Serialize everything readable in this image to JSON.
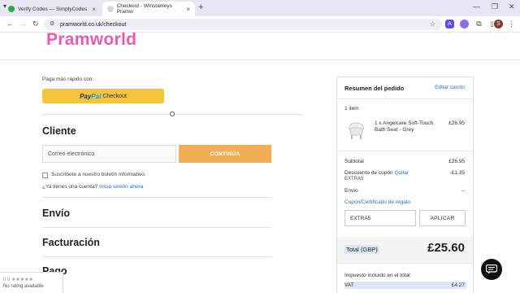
{
  "browser": {
    "tabs": [
      {
        "title": "Verify Codes — SimplyCodes",
        "active": false
      },
      {
        "title": "Checkout - Winstanleys Pramw",
        "active": true
      }
    ],
    "new_tab": "+",
    "url": "pramworld.co.uk/checkout",
    "profile_initial": "S"
  },
  "site": {
    "logo": "Pramworld"
  },
  "checkout": {
    "fast_pay_label": "Paga más rápido con:",
    "paypal_checkout": "Checkout",
    "customer_heading": "Cliente",
    "email_placeholder": "Correo electrónico",
    "continue_button": "CONTINÚA",
    "newsletter_label": "Suscríbete a nuestro boletín informativo.",
    "account_question": "¿Ya tienes una cuenta?",
    "login_link": "Inicia sesión ahora",
    "shipping_heading": "Envío",
    "billing_heading": "Facturación",
    "payment_heading": "Pago"
  },
  "summary": {
    "title": "Resumen del pedido",
    "edit_cart": "Editar carrito",
    "item_count": "1 item",
    "product": {
      "name": "1 x Angelcare Soft-Touch Bath Seat - Grey",
      "price": "£26.95"
    },
    "subtotal_label": "Subtotal",
    "subtotal_value": "£26.95",
    "coupon_label": "Descuento de cupón",
    "coupon_remove": "Quitar",
    "coupon_code": "EXTRA5",
    "coupon_value": "-£1.35",
    "shipping_label": "Envío",
    "shipping_value": "--",
    "voucher_link": "Cupón/Certificado de regalo",
    "voucher_input": "EXTRA5",
    "apply_button": "APLICAR",
    "total_label": "Total (GBP)",
    "total_value": "£25.60",
    "tax_label": "Impuesto incluido en el total:",
    "vat_label": "VAT",
    "vat_value": "£4.27"
  },
  "review_widget": {
    "stars": "0.0 ★★★★★",
    "text": "No rating available"
  }
}
